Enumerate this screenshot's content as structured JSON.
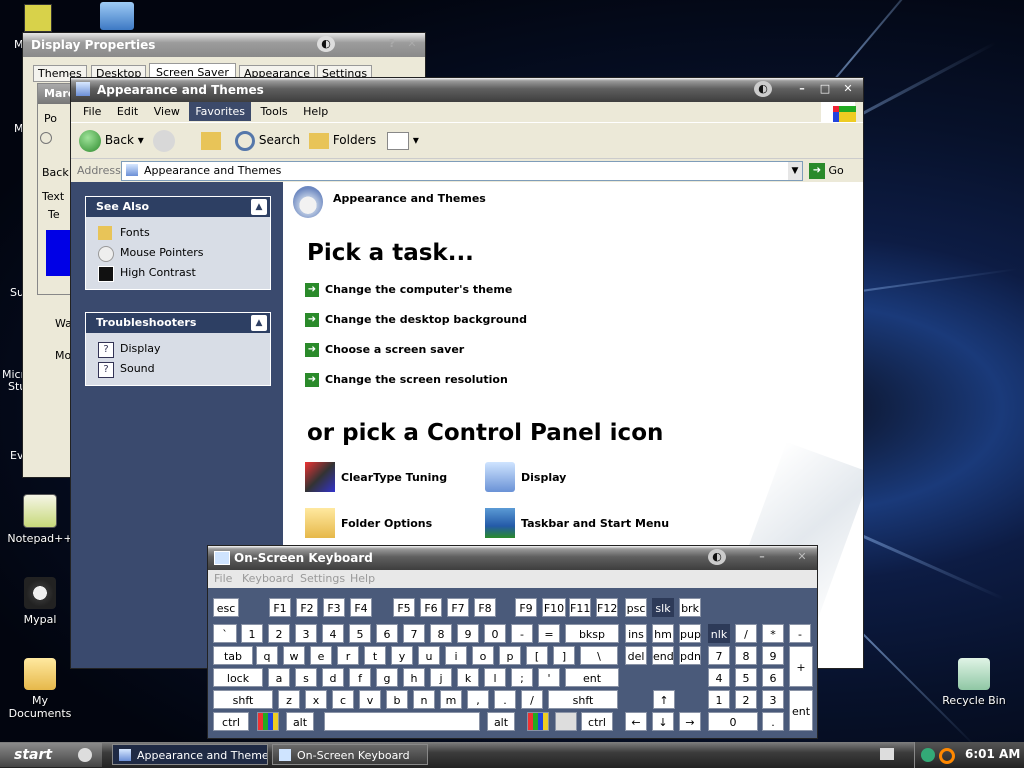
{
  "desktop": {
    "icons": [
      {
        "label": "Notepad++"
      },
      {
        "label": "Mypal"
      },
      {
        "label": "My Documents"
      },
      {
        "label": "Recycle Bin"
      }
    ],
    "left_edge_fragments": [
      "M",
      "M",
      "Su",
      "Micro",
      "Stu",
      "Ev"
    ]
  },
  "display_properties": {
    "title": "Display Properties",
    "tabs": [
      "Themes",
      "Desktop",
      "Screen Saver",
      "Appearance",
      "Settings"
    ],
    "fragments": [
      "Marc",
      "Po",
      "Back",
      "Text",
      "Te",
      "Wa",
      "Mo"
    ]
  },
  "explorer": {
    "title": "Appearance and Themes",
    "menu": [
      "File",
      "Edit",
      "View",
      "Favorites",
      "Tools",
      "Help"
    ],
    "toolbar": {
      "back": "Back",
      "search": "Search",
      "folders": "Folders"
    },
    "address": {
      "label": "Address",
      "value": "Appearance and Themes",
      "go": "Go"
    },
    "see_also": {
      "title": "See Also",
      "items": [
        "Fonts",
        "Mouse Pointers",
        "High Contrast"
      ]
    },
    "troubleshooters": {
      "title": "Troubleshooters",
      "items": [
        "Display",
        "Sound"
      ]
    },
    "main": {
      "header": "Appearance and Themes",
      "pick_task": "Pick a task...",
      "tasks": [
        "Change the computer's theme",
        "Change the desktop background",
        "Choose a screen saver",
        "Change the screen resolution"
      ],
      "pick_icon": "or pick a Control Panel icon",
      "icons": [
        "ClearType Tuning",
        "Display",
        "Folder Options",
        "Taskbar and Start Menu"
      ]
    }
  },
  "osk": {
    "title": "On-Screen Keyboard",
    "menu": [
      "File",
      "Keyboard",
      "Settings",
      "Help"
    ],
    "rows": [
      [
        "esc",
        "F1",
        "F2",
        "F3",
        "F4",
        "F5",
        "F6",
        "F7",
        "F8",
        "F9",
        "F10",
        "F11",
        "F12",
        "psc",
        "slk",
        "brk"
      ],
      [
        "`",
        "1",
        "2",
        "3",
        "4",
        "5",
        "6",
        "7",
        "8",
        "9",
        "0",
        "-",
        "=",
        "bksp",
        "ins",
        "hm",
        "pup",
        "nlk",
        "/",
        "*",
        "-"
      ],
      [
        "tab",
        "q",
        "w",
        "e",
        "r",
        "t",
        "y",
        "u",
        "i",
        "o",
        "p",
        "[",
        "]",
        "\\",
        "del",
        "end",
        "pdn",
        "7",
        "8",
        "9",
        "+"
      ],
      [
        "lock",
        "a",
        "s",
        "d",
        "f",
        "g",
        "h",
        "j",
        "k",
        "l",
        ";",
        "'",
        "ent",
        "4",
        "5",
        "6"
      ],
      [
        "shft",
        "z",
        "x",
        "c",
        "v",
        "b",
        "n",
        "m",
        ",",
        ".",
        "/",
        "shft",
        "↑",
        "1",
        "2",
        "3",
        "ent"
      ],
      [
        "ctrl",
        "alt",
        "alt",
        "ctrl",
        "←",
        "↓",
        "→",
        "0",
        "."
      ]
    ]
  },
  "taskbar": {
    "start": "start",
    "tasks": [
      "Appearance and Themes",
      "On-Screen Keyboard"
    ],
    "clock": "6:01 AM"
  },
  "colors": {
    "title_gradient": "#3e3e3e",
    "sidebar": "#3a4a6e",
    "panel_head": "#2d3f63",
    "task_arrow": "#2a8a2a",
    "keyboard_bg": "#4a5a7a"
  }
}
